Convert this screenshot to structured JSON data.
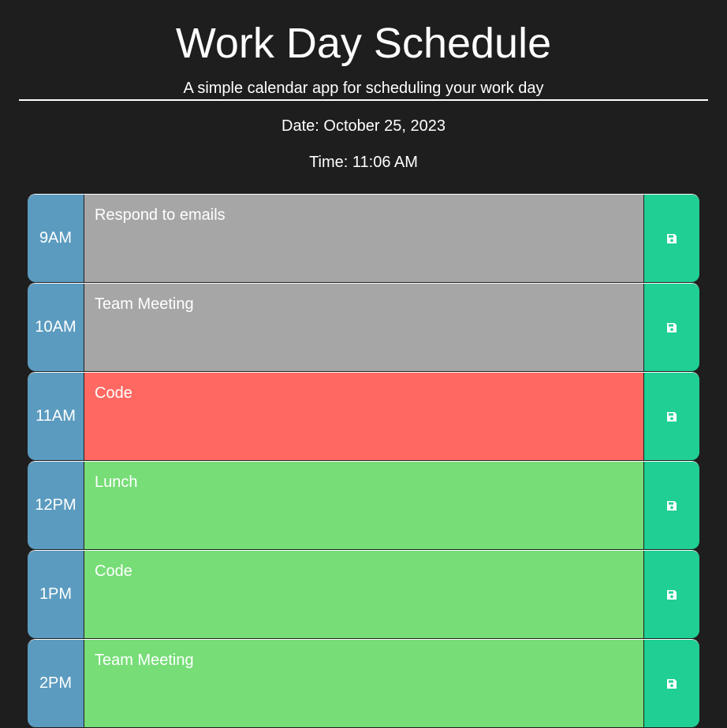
{
  "header": {
    "title": "Work Day Schedule",
    "subtitle": "A simple calendar app for scheduling your work day"
  },
  "current": {
    "date": "Date: October 25, 2023",
    "time": "Time: 11:06 AM"
  },
  "colors": {
    "background": "#1e1e1e",
    "hour": "#5b9bbf",
    "past": "#a6a6a6",
    "present": "#ff6961",
    "future": "#77dd77",
    "save": "#1fcf94"
  },
  "save_icon": "floppy-disk-icon",
  "blocks": [
    {
      "hour": "9AM",
      "text": "Respond to emails",
      "status": "past"
    },
    {
      "hour": "10AM",
      "text": "Team Meeting",
      "status": "past"
    },
    {
      "hour": "11AM",
      "text": "Code",
      "status": "present"
    },
    {
      "hour": "12PM",
      "text": "Lunch",
      "status": "future"
    },
    {
      "hour": "1PM",
      "text": "Code",
      "status": "future"
    },
    {
      "hour": "2PM",
      "text": "Team Meeting",
      "status": "future"
    }
  ]
}
